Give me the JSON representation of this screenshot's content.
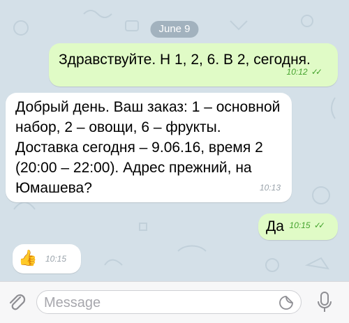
{
  "chat": {
    "date_label": "June 9",
    "messages": [
      {
        "direction": "out",
        "text": "Здравствуйте. Н 1, 2, 6. В 2, сегодня.",
        "time": "10:12",
        "status": "read"
      },
      {
        "direction": "in",
        "text": "Добрый день. Ваш заказ: 1 – основной набор, 2 – овощи, 6 – фрукты. Доставка сегодня – 9.06.16, время 2 (20:00 – 22:00). Адрес прежний, на Юмашева?",
        "time": "10:13"
      },
      {
        "direction": "out",
        "text": "Да",
        "time": "10:15",
        "status": "read"
      },
      {
        "direction": "in",
        "text": "👍",
        "time": "10:15"
      }
    ]
  },
  "composer": {
    "placeholder": "Message",
    "value": ""
  },
  "icons": {
    "attach": "paperclip-icon",
    "sticker": "sticker-icon",
    "mic": "microphone-icon",
    "read_status": "double-check-icon"
  },
  "colors": {
    "outgoing_bubble": "#e0fbc6",
    "incoming_bubble": "#ffffff",
    "read_check": "#45a32e",
    "chat_background": "#d4e0e8"
  }
}
